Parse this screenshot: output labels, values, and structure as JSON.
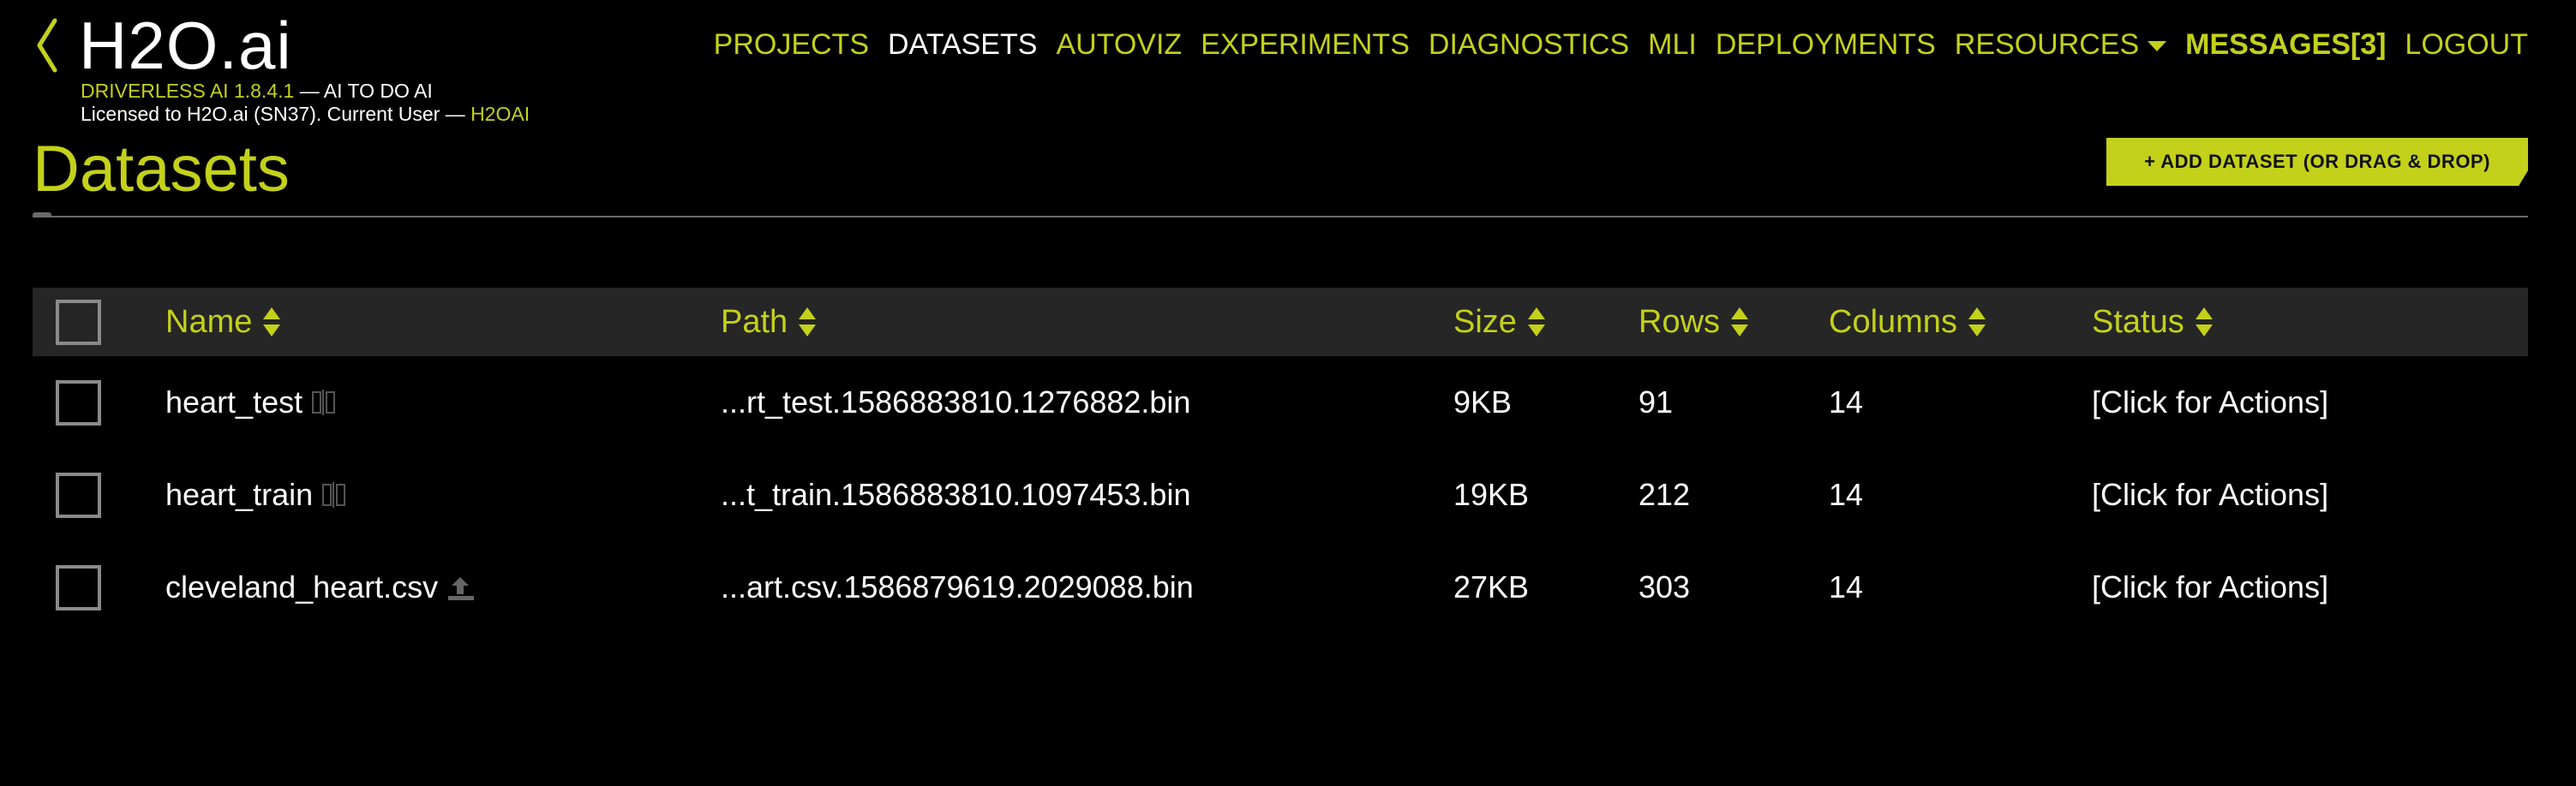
{
  "brand": {
    "name": "H2O.ai",
    "product_version": "DRIVERLESS AI 1.8.4.1",
    "tagline": "— AI TO DO AI",
    "license_prefix": "Licensed to H2O.ai (SN37). Current User —",
    "current_user": "H2OAI"
  },
  "nav": {
    "items": [
      {
        "label": "PROJECTS"
      },
      {
        "label": "DATASETS",
        "active": true
      },
      {
        "label": "AUTOVIZ"
      },
      {
        "label": "EXPERIMENTS"
      },
      {
        "label": "DIAGNOSTICS"
      },
      {
        "label": "MLI"
      },
      {
        "label": "DEPLOYMENTS"
      },
      {
        "label": "RESOURCES",
        "dropdown": true
      },
      {
        "label": "MESSAGES[3]"
      },
      {
        "label": "LOGOUT"
      }
    ]
  },
  "page": {
    "title": "Datasets",
    "add_button_label": "+ ADD DATASET (OR DRAG & DROP)"
  },
  "table": {
    "columns": [
      "Name",
      "Path",
      "Size",
      "Rows",
      "Columns",
      "Status"
    ],
    "rows": [
      {
        "name": "heart_test",
        "icon": "split-icon",
        "path": "...rt_test.1586883810.1276882.bin",
        "size": "9KB",
        "rows": "91",
        "columns": "14",
        "status": "[Click for Actions]"
      },
      {
        "name": "heart_train",
        "icon": "split-icon",
        "path": "...t_train.1586883810.1097453.bin",
        "size": "19KB",
        "rows": "212",
        "columns": "14",
        "status": "[Click for Actions]"
      },
      {
        "name": "cleveland_heart.csv",
        "icon": "upload-icon",
        "path": "...art.csv.1586879619.2029088.bin",
        "size": "27KB",
        "rows": "303",
        "columns": "14",
        "status": "[Click for Actions]"
      }
    ]
  },
  "colors": {
    "accent": "#c3d11a",
    "background": "#000000",
    "header_row": "#262626",
    "checkbox_border": "#8a8a8a"
  }
}
